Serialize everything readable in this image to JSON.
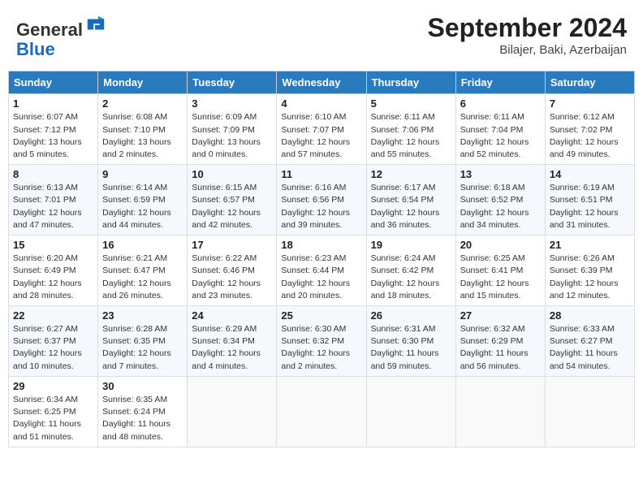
{
  "header": {
    "logo_general": "General",
    "logo_blue": "Blue",
    "month_year": "September 2024",
    "location": "Bilajer, Baki, Azerbaijan"
  },
  "days_of_week": [
    "Sunday",
    "Monday",
    "Tuesday",
    "Wednesday",
    "Thursday",
    "Friday",
    "Saturday"
  ],
  "weeks": [
    [
      {
        "day": "1",
        "info": "Sunrise: 6:07 AM\nSunset: 7:12 PM\nDaylight: 13 hours\nand 5 minutes."
      },
      {
        "day": "2",
        "info": "Sunrise: 6:08 AM\nSunset: 7:10 PM\nDaylight: 13 hours\nand 2 minutes."
      },
      {
        "day": "3",
        "info": "Sunrise: 6:09 AM\nSunset: 7:09 PM\nDaylight: 13 hours\nand 0 minutes."
      },
      {
        "day": "4",
        "info": "Sunrise: 6:10 AM\nSunset: 7:07 PM\nDaylight: 12 hours\nand 57 minutes."
      },
      {
        "day": "5",
        "info": "Sunrise: 6:11 AM\nSunset: 7:06 PM\nDaylight: 12 hours\nand 55 minutes."
      },
      {
        "day": "6",
        "info": "Sunrise: 6:11 AM\nSunset: 7:04 PM\nDaylight: 12 hours\nand 52 minutes."
      },
      {
        "day": "7",
        "info": "Sunrise: 6:12 AM\nSunset: 7:02 PM\nDaylight: 12 hours\nand 49 minutes."
      }
    ],
    [
      {
        "day": "8",
        "info": "Sunrise: 6:13 AM\nSunset: 7:01 PM\nDaylight: 12 hours\nand 47 minutes."
      },
      {
        "day": "9",
        "info": "Sunrise: 6:14 AM\nSunset: 6:59 PM\nDaylight: 12 hours\nand 44 minutes."
      },
      {
        "day": "10",
        "info": "Sunrise: 6:15 AM\nSunset: 6:57 PM\nDaylight: 12 hours\nand 42 minutes."
      },
      {
        "day": "11",
        "info": "Sunrise: 6:16 AM\nSunset: 6:56 PM\nDaylight: 12 hours\nand 39 minutes."
      },
      {
        "day": "12",
        "info": "Sunrise: 6:17 AM\nSunset: 6:54 PM\nDaylight: 12 hours\nand 36 minutes."
      },
      {
        "day": "13",
        "info": "Sunrise: 6:18 AM\nSunset: 6:52 PM\nDaylight: 12 hours\nand 34 minutes."
      },
      {
        "day": "14",
        "info": "Sunrise: 6:19 AM\nSunset: 6:51 PM\nDaylight: 12 hours\nand 31 minutes."
      }
    ],
    [
      {
        "day": "15",
        "info": "Sunrise: 6:20 AM\nSunset: 6:49 PM\nDaylight: 12 hours\nand 28 minutes."
      },
      {
        "day": "16",
        "info": "Sunrise: 6:21 AM\nSunset: 6:47 PM\nDaylight: 12 hours\nand 26 minutes."
      },
      {
        "day": "17",
        "info": "Sunrise: 6:22 AM\nSunset: 6:46 PM\nDaylight: 12 hours\nand 23 minutes."
      },
      {
        "day": "18",
        "info": "Sunrise: 6:23 AM\nSunset: 6:44 PM\nDaylight: 12 hours\nand 20 minutes."
      },
      {
        "day": "19",
        "info": "Sunrise: 6:24 AM\nSunset: 6:42 PM\nDaylight: 12 hours\nand 18 minutes."
      },
      {
        "day": "20",
        "info": "Sunrise: 6:25 AM\nSunset: 6:41 PM\nDaylight: 12 hours\nand 15 minutes."
      },
      {
        "day": "21",
        "info": "Sunrise: 6:26 AM\nSunset: 6:39 PM\nDaylight: 12 hours\nand 12 minutes."
      }
    ],
    [
      {
        "day": "22",
        "info": "Sunrise: 6:27 AM\nSunset: 6:37 PM\nDaylight: 12 hours\nand 10 minutes."
      },
      {
        "day": "23",
        "info": "Sunrise: 6:28 AM\nSunset: 6:35 PM\nDaylight: 12 hours\nand 7 minutes."
      },
      {
        "day": "24",
        "info": "Sunrise: 6:29 AM\nSunset: 6:34 PM\nDaylight: 12 hours\nand 4 minutes."
      },
      {
        "day": "25",
        "info": "Sunrise: 6:30 AM\nSunset: 6:32 PM\nDaylight: 12 hours\nand 2 minutes."
      },
      {
        "day": "26",
        "info": "Sunrise: 6:31 AM\nSunset: 6:30 PM\nDaylight: 11 hours\nand 59 minutes."
      },
      {
        "day": "27",
        "info": "Sunrise: 6:32 AM\nSunset: 6:29 PM\nDaylight: 11 hours\nand 56 minutes."
      },
      {
        "day": "28",
        "info": "Sunrise: 6:33 AM\nSunset: 6:27 PM\nDaylight: 11 hours\nand 54 minutes."
      }
    ],
    [
      {
        "day": "29",
        "info": "Sunrise: 6:34 AM\nSunset: 6:25 PM\nDaylight: 11 hours\nand 51 minutes."
      },
      {
        "day": "30",
        "info": "Sunrise: 6:35 AM\nSunset: 6:24 PM\nDaylight: 11 hours\nand 48 minutes."
      },
      {
        "day": "",
        "info": ""
      },
      {
        "day": "",
        "info": ""
      },
      {
        "day": "",
        "info": ""
      },
      {
        "day": "",
        "info": ""
      },
      {
        "day": "",
        "info": ""
      }
    ]
  ]
}
